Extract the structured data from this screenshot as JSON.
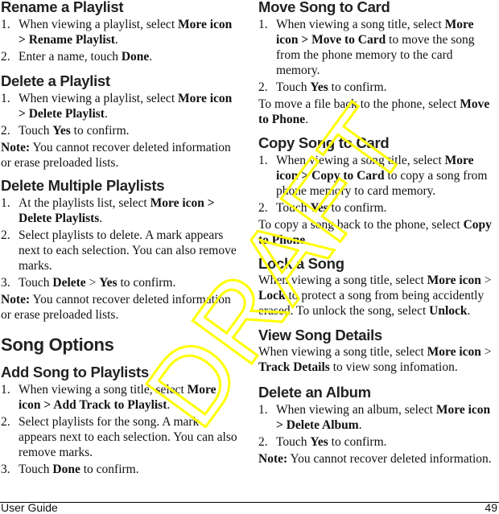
{
  "watermark": {
    "text": "DRAFT",
    "color": "#ffff00"
  },
  "left": {
    "rename": {
      "title": "Rename a Playlist",
      "steps": [
        {
          "n": "1.",
          "parts": [
            "When viewing a playlist, select ",
            "More icon",
            " ",
            "> Rename Playlist",
            "."
          ]
        },
        {
          "n": "2.",
          "parts": [
            "Enter a name, touch ",
            "Done",
            "."
          ]
        }
      ]
    },
    "delete": {
      "title": "Delete a Playlist",
      "steps": [
        {
          "n": "1.",
          "parts": [
            "When viewing a playlist, select ",
            "More icon",
            " ",
            "> Delete Playlist",
            "."
          ]
        },
        {
          "n": "2.",
          "parts": [
            "Touch ",
            "Yes",
            " to confirm."
          ]
        }
      ],
      "note_label": "Note:",
      "note_text": " You cannot recover deleted information or erase preloaded lists."
    },
    "delete_multiple": {
      "title": "Delete Multiple Playlists",
      "steps": [
        {
          "n": "1.",
          "parts": [
            "At the playlists list, select ",
            "More icon >",
            " ",
            "Delete Playlists",
            "."
          ]
        },
        {
          "n": "2.",
          "parts": [
            "Select playlists to delete. A mark appears next to each selection. You can also remove marks."
          ]
        },
        {
          "n": "3.",
          "parts": [
            "Touch ",
            "Delete",
            " > ",
            "Yes",
            " to confirm."
          ]
        }
      ],
      "note_label": "Note:",
      "note_text": " You cannot recover deleted information or erase preloaded lists."
    },
    "section_title": "Song Options",
    "add_song": {
      "title": "Add Song to Playlists",
      "steps": [
        {
          "n": "1.",
          "parts": [
            "When viewing a song title, select ",
            "More icon > Add Track to Playlist",
            "."
          ]
        },
        {
          "n": "2.",
          "parts": [
            "Select playlists for the song. A mark appears next to each selection. You can also remove marks."
          ]
        },
        {
          "n": "3.",
          "parts": [
            "Touch ",
            "Done",
            " to confirm."
          ]
        }
      ]
    }
  },
  "right": {
    "move": {
      "title": "Move Song to Card",
      "steps": [
        {
          "n": "1.",
          "parts": [
            "When viewing a song title, select ",
            "More icon > Move to Card",
            " to move the song from the phone memory to the card memory."
          ]
        },
        {
          "n": "2.",
          "parts": [
            "Touch ",
            "Yes",
            " to confirm."
          ]
        }
      ],
      "extra_pre": "To move a file back to the phone, select ",
      "extra_bold": "Move to Phone",
      "extra_post": "."
    },
    "copy": {
      "title": "Copy Song to Card",
      "steps": [
        {
          "n": "1.",
          "parts": [
            "When viewing a song title, select ",
            "More icon > Copy to Card",
            " to copy a song from phone memory to card memory."
          ]
        },
        {
          "n": "2.",
          "parts": [
            "Touch ",
            "Yes",
            " to confirm."
          ]
        }
      ],
      "extra_pre": "To copy a song back to the phone, select ",
      "extra_bold": "Copy to Phone",
      "extra_post": "."
    },
    "lock": {
      "title": "Lock a Song",
      "p1": "When viewing a song title, select ",
      "b1": "More icon",
      "p2": " > ",
      "b2": "Lock",
      "p3": " to protect a song from being accidently erased. To unlock the song, select ",
      "b3": "Unlock",
      "p4": "."
    },
    "details": {
      "title": "View Song Details",
      "p1": "When viewing a song title, select ",
      "b1": "More icon",
      "p2": " > ",
      "b2": "Track Details",
      "p3": " to view song infomation."
    },
    "album": {
      "title": "Delete an Album",
      "steps": [
        {
          "n": "1.",
          "parts": [
            "When viewing an album, select ",
            "More icon",
            " ",
            "> Delete Album",
            "."
          ]
        },
        {
          "n": "2.",
          "parts": [
            "Touch ",
            "Yes",
            " to confirm."
          ]
        }
      ],
      "note_label": "Note:",
      "note_text": " You cannot recover deleted information."
    }
  },
  "footer": {
    "left": "User Guide",
    "page": "49"
  }
}
